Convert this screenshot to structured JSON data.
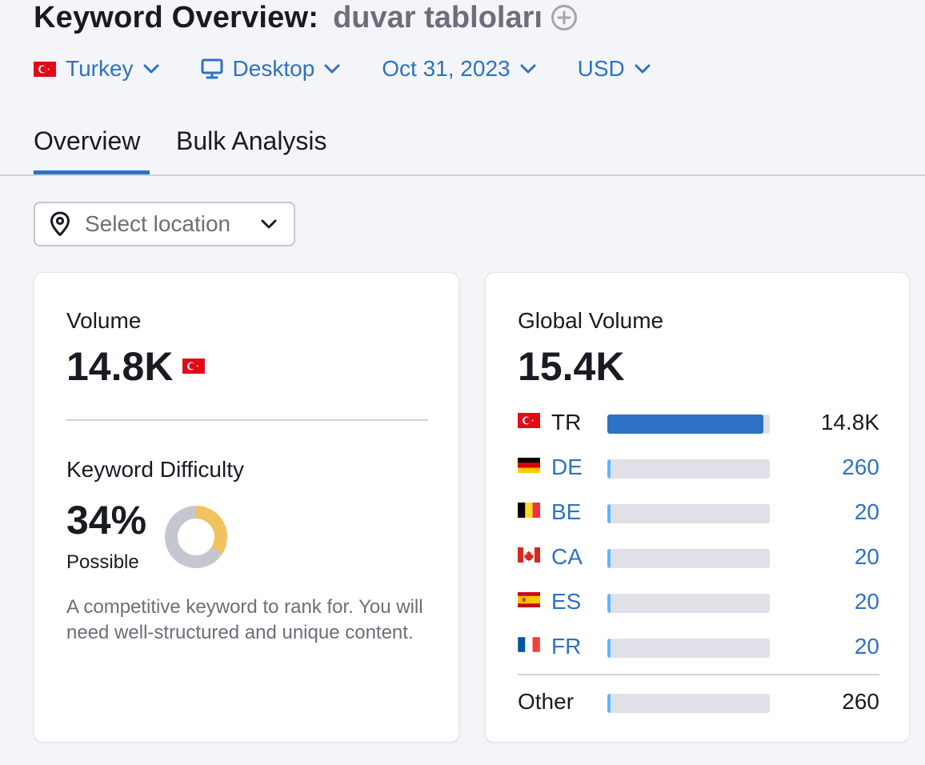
{
  "header": {
    "title": "Keyword Overview:",
    "keyword": "duvar tabloları"
  },
  "filters": {
    "country": "Turkey",
    "device": "Desktop",
    "date": "Oct 31, 2023",
    "currency": "USD"
  },
  "tabs": [
    {
      "label": "Overview",
      "active": true
    },
    {
      "label": "Bulk Analysis",
      "active": false
    }
  ],
  "location_select": {
    "placeholder": "Select location"
  },
  "volume_card": {
    "label": "Volume",
    "value": "14.8K",
    "country_flag": "tr-flag"
  },
  "kd_card": {
    "label": "Keyword Difficulty",
    "value": "34%",
    "percent": 34,
    "level": "Possible",
    "description": "A competitive keyword to rank for. You will need well-structured and unique content.",
    "colors": {
      "filled": "#f2c25e",
      "empty": "#c4c7cf"
    }
  },
  "global_volume": {
    "label": "Global Volume",
    "value": "15.4K",
    "rows": [
      {
        "flag": "tr-flag",
        "code": "TR",
        "value": "14.8K",
        "fraction": 0.96,
        "link": false
      },
      {
        "flag": "de-flag",
        "code": "DE",
        "value": "260",
        "fraction": 0.017,
        "link": true
      },
      {
        "flag": "be-flag",
        "code": "BE",
        "value": "20",
        "fraction": 0.013,
        "link": true
      },
      {
        "flag": "ca-flag",
        "code": "CA",
        "value": "20",
        "fraction": 0.013,
        "link": true
      },
      {
        "flag": "es-flag",
        "code": "ES",
        "value": "20",
        "fraction": 0.013,
        "link": true
      },
      {
        "flag": "fr-flag",
        "code": "FR",
        "value": "20",
        "fraction": 0.013,
        "link": true
      }
    ],
    "other": {
      "label": "Other",
      "value": "260",
      "fraction": 0.017
    },
    "colors": {
      "primary_fill": "#2d72c4",
      "minor_fill": "#5fb4ff",
      "track": "#dfe0e8"
    }
  }
}
